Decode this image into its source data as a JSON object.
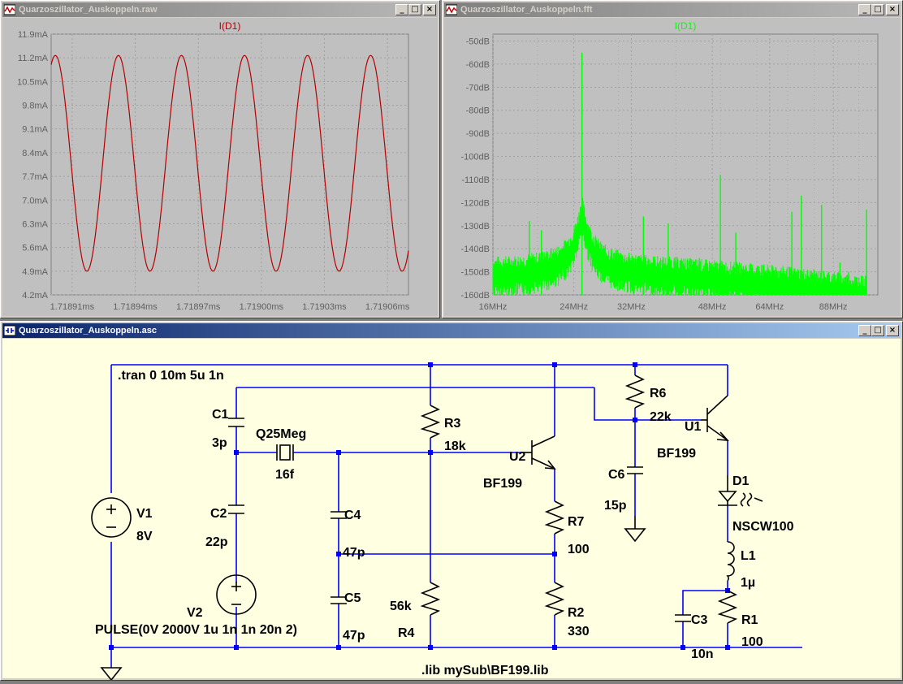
{
  "windows": {
    "waveform": {
      "title": "Quarzoszillator_Auskoppeln.raw"
    },
    "fft": {
      "title": "Quarzoszillator_Auskoppeln.fft"
    },
    "schematic": {
      "title": "Quarzoszillator_Auskoppeln.asc"
    }
  },
  "window_buttons": {
    "minimize": "_",
    "maximize": "□",
    "close": "×"
  },
  "colors": {
    "trace_waveform": "#b40000",
    "trace_fft": "#00ff00",
    "wire": "#0000ff",
    "plot_bg": "#c0c0c0",
    "schematic_bg": "#ffffe1"
  },
  "chart_data": [
    {
      "type": "line",
      "series": [
        {
          "name": "I(D1)",
          "color": "#b40000"
        }
      ],
      "yticks": [
        "11.9mA",
        "11.2mA",
        "10.5mA",
        "9.8mA",
        "9.1mA",
        "8.4mA",
        "7.7mA",
        "7.0mA",
        "6.3mA",
        "5.6mA",
        "4.9mA",
        "4.2mA"
      ],
      "xticks": [
        "1.71891ms",
        "1.71894ms",
        "1.71897ms",
        "1.71900ms",
        "1.71903ms",
        "1.71906ms"
      ],
      "ylim": [
        4.2,
        11.9
      ],
      "xlim": [
        1.7189,
        1.71907
      ],
      "wave": {
        "min": 4.9,
        "max": 11.27,
        "period_ms": 3e-05,
        "first_peak_ms": 1.718932,
        "start_ms": 1.7189,
        "end_ms": 1.717907,
        "x_end_ms": 1.71907
      },
      "grid": true
    },
    {
      "type": "line",
      "series": [
        {
          "name": "I(D1)",
          "color": "#00ff00"
        }
      ],
      "yticks": [
        "-50dB",
        "-60dB",
        "-70dB",
        "-80dB",
        "-90dB",
        "-100dB",
        "-110dB",
        "-120dB",
        "-130dB",
        "-140dB",
        "-150dB",
        "-160dB"
      ],
      "xticks": [
        "16MHz",
        "24MHz",
        "32MHz",
        "48MHz",
        "64MHz",
        "88MHz"
      ],
      "ylim": [
        -160,
        -47
      ],
      "xscale": "log",
      "xlim": [
        16,
        110
      ],
      "x_tick_values": [
        16,
        24,
        32,
        48,
        64,
        88
      ],
      "peaks": [
        {
          "f": 25,
          "db": -55
        },
        {
          "f": 19.2,
          "db": -128
        },
        {
          "f": 20.4,
          "db": -132
        },
        {
          "f": 34,
          "db": -126
        },
        {
          "f": 38.5,
          "db": -129
        },
        {
          "f": 50,
          "db": -108
        },
        {
          "f": 45,
          "db": -144
        },
        {
          "f": 54,
          "db": -133
        },
        {
          "f": 57,
          "db": -150
        },
        {
          "f": 61.5,
          "db": -147
        },
        {
          "f": 66,
          "db": -148
        },
        {
          "f": 71.5,
          "db": -124
        },
        {
          "f": 75,
          "db": -117
        },
        {
          "f": 83,
          "db": -121
        },
        {
          "f": 86,
          "db": -150
        },
        {
          "f": 91,
          "db": -146
        },
        {
          "f": 95,
          "db": -150
        },
        {
          "f": 104,
          "db": -123
        }
      ],
      "grid": true
    }
  ],
  "schematic": {
    "directives": {
      "tran": ".tran 0 10m 5u 1n",
      "lib": ".lib mySub\\BF199.lib",
      "pulse": "PULSE(0V 2000V 1u 1n 1n 20n 2)"
    },
    "components": {
      "C1": {
        "name": "C1",
        "value": "3p"
      },
      "C2": {
        "name": "C2",
        "value": "22p"
      },
      "C3": {
        "name": "C3",
        "value": "10n"
      },
      "C4": {
        "name": "C4",
        "value": "47p"
      },
      "C5": {
        "name": "C5",
        "value": "47p"
      },
      "C6": {
        "name": "C6",
        "value": "15p"
      },
      "R1": {
        "name": "R1",
        "value": "100"
      },
      "R2": {
        "name": "R2",
        "value": "330"
      },
      "R3": {
        "name": "R3",
        "value": "18k"
      },
      "R4": {
        "name": "R4",
        "value": "56k"
      },
      "R6": {
        "name": "R6",
        "value": "22k"
      },
      "R7": {
        "name": "R7",
        "value": "100"
      },
      "V1": {
        "name": "V1",
        "value": "8V"
      },
      "V2": {
        "name": "V2"
      },
      "Q": {
        "name": "Q25Meg",
        "value": "16f"
      },
      "U1": {
        "name": "U1",
        "value": "BF199"
      },
      "U2": {
        "name": "U2",
        "value": "BF199"
      },
      "D1": {
        "name": "D1",
        "value": "NSCW100"
      },
      "L1": {
        "name": "L1",
        "value": "1µ"
      }
    }
  }
}
